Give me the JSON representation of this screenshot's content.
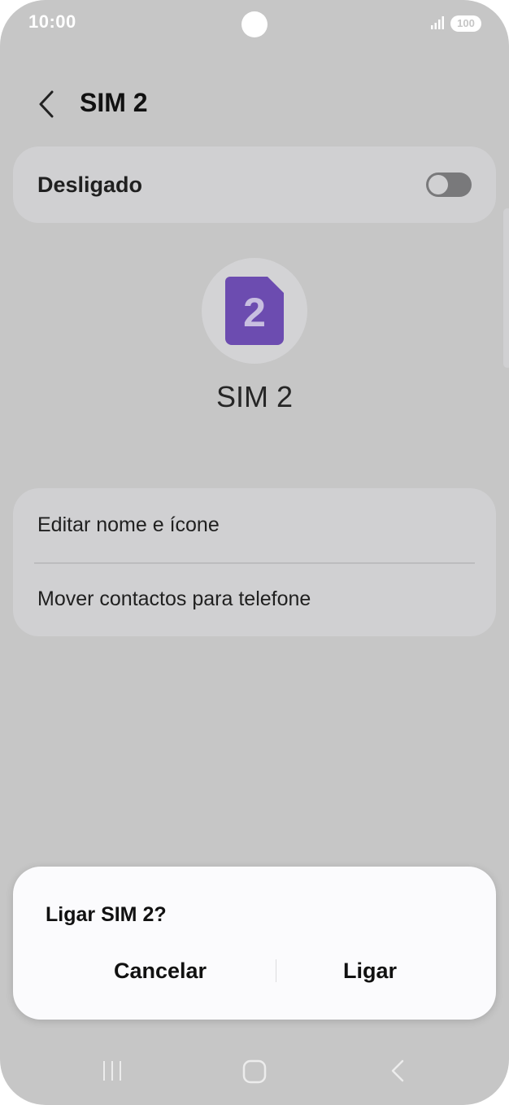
{
  "status_bar": {
    "time": "10:00",
    "battery": "100",
    "icons": [
      "signal-icon",
      "battery-icon"
    ]
  },
  "header": {
    "title": "SIM 2",
    "back_icon": "back-chevron-icon"
  },
  "toggle": {
    "label": "Desligado",
    "state": "off"
  },
  "sim": {
    "number": "2",
    "name": "SIM 2",
    "icon_color": "#6c4cb0"
  },
  "options": [
    {
      "label": "Editar nome e ícone"
    },
    {
      "label": "Mover contactos para telefone"
    }
  ],
  "dialog": {
    "title": "Ligar SIM 2?",
    "cancel_label": "Cancelar",
    "confirm_label": "Ligar"
  },
  "nav_bar": {
    "icons": [
      "recents-icon",
      "home-icon",
      "back-icon"
    ]
  }
}
